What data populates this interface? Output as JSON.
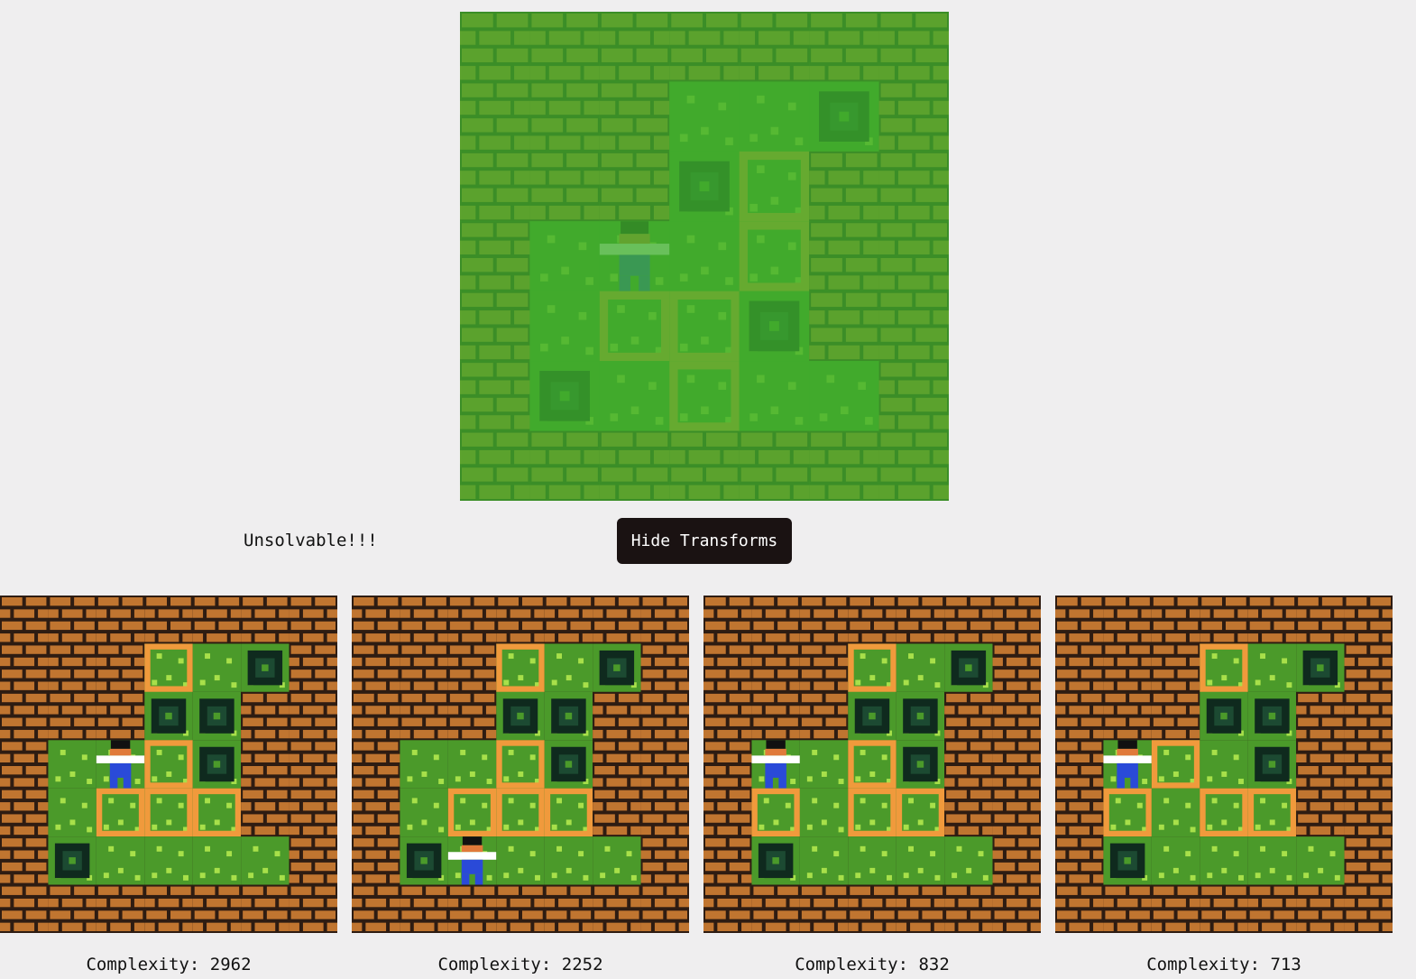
{
  "status": {
    "message": "Unsolvable!!!"
  },
  "toolbar": {
    "hide_transforms_label": "Hide Transforms"
  },
  "colors": {
    "wall_brick": "#c07530",
    "wall_mortar": "#2e1c12",
    "floor": "#4b9a2a",
    "floor_dot": "#a8e04a",
    "box_outline": "#f09a3c",
    "goal": "#0f2a1e",
    "green_tint": "#3fae2d",
    "button_bg": "#1a1212"
  },
  "main_view": {
    "icon": "sokoban-level-preview",
    "description_icon_player": "player-sprite"
  },
  "transforms": [
    {
      "complexity_label": "Complexity: 2962"
    },
    {
      "complexity_label": "Complexity: 2252"
    },
    {
      "complexity_label": "Complexity: 832"
    },
    {
      "complexity_label": "Complexity: 713"
    }
  ]
}
